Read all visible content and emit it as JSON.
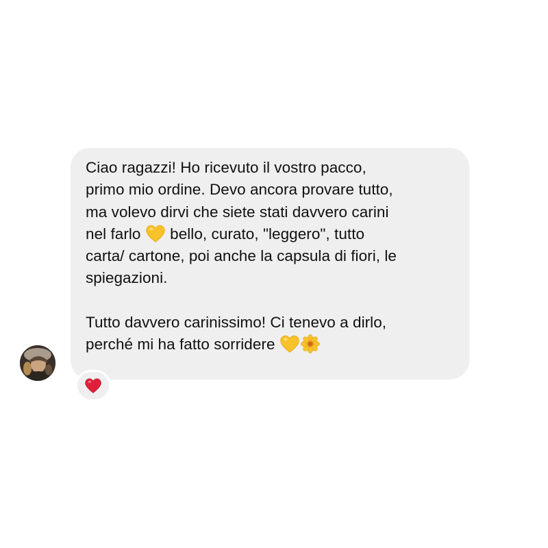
{
  "message": {
    "paragraph1": [
      "Ciao ragazzi! Ho ricevuto il vostro pacco,",
      "primo mio ordine. Devo ancora provare tutto,",
      "ma volevo dirvi che siete stati davvero carini",
      {
        "before": "nel farlo",
        "emoji": "yellow-heart",
        "after": "bello, curato, \"leggero\", tutto"
      },
      "carta/ cartone, poi anche la capsula di fiori, le",
      "spiegazioni."
    ],
    "paragraph2": [
      "Tutto davvero carinissimo! Ci tenevo a dirlo,",
      {
        "before": "perché mi ha fatto sorridere",
        "emojis": [
          "yellow-heart",
          "blossom"
        ]
      }
    ]
  },
  "reaction": {
    "icon": "red-heart"
  },
  "avatar": {
    "icon": "profile-photo"
  },
  "colors": {
    "bubble": "#efefef",
    "text": "#101010",
    "yellow_heart": "#f8c32a",
    "red_heart": "#e0203a"
  }
}
